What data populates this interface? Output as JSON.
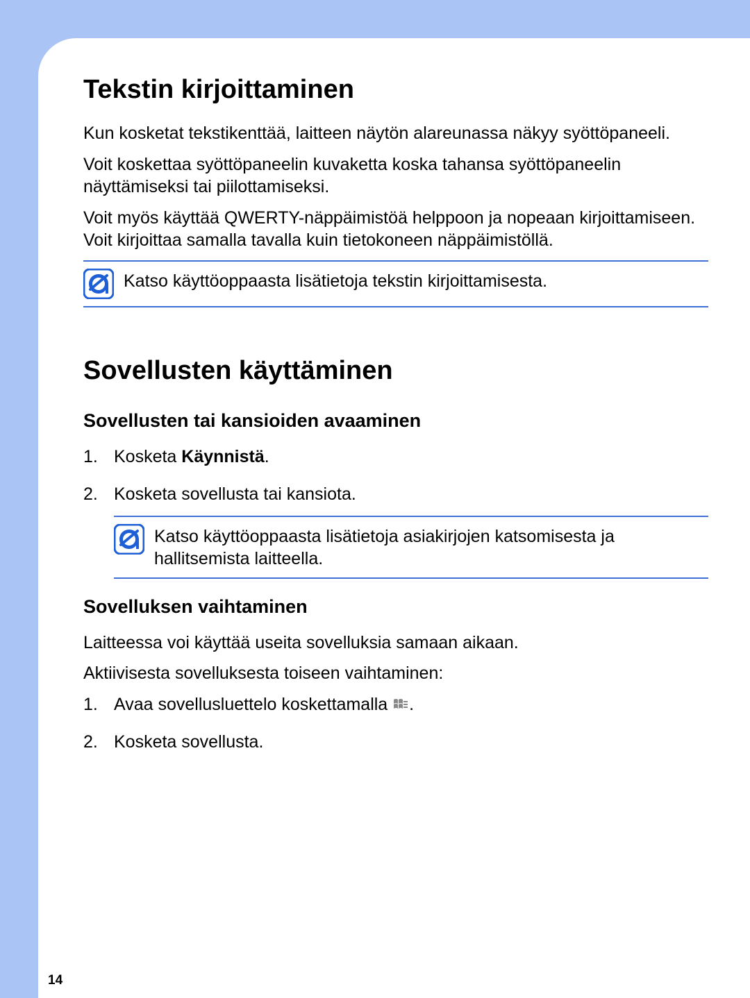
{
  "page_number": "14",
  "section1": {
    "heading": "Tekstin kirjoittaminen",
    "p1": "Kun kosketat tekstikenttää, laitteen näytön alareunassa näkyy syöttöpaneeli.",
    "p2": "Voit koskettaa syöttöpaneelin kuvaketta koska tahansa syöttöpaneelin näyttämiseksi tai piilottamiseksi.",
    "p3": "Voit myös käyttää QWERTY-näppäimistöä helppoon ja nopeaan kirjoittamiseen. Voit kirjoittaa samalla tavalla kuin tietokoneen näppäimistöllä.",
    "callout": "Katso käyttöoppaasta lisätietoja tekstin kirjoittamisesta."
  },
  "section2": {
    "heading": "Sovellusten käyttäminen",
    "sub1": {
      "heading": "Sovellusten tai kansioiden avaaminen",
      "step1_prefix": "Kosketa ",
      "step1_bold": "Käynnistä",
      "step1_suffix": ".",
      "step2": "Kosketa sovellusta tai kansiota.",
      "callout": "Katso käyttöoppaasta lisätietoja asiakirjojen katsomisesta ja hallitsemista laitteella."
    },
    "sub2": {
      "heading": "Sovelluksen vaihtaminen",
      "p1": "Laitteessa voi käyttää useita sovelluksia samaan aikaan.",
      "p2": "Aktiivisesta sovelluksesta toiseen vaihtaminen:",
      "step1_prefix": "Avaa sovellusluettelo koskettamalla ",
      "step1_suffix": ".",
      "step2": "Kosketa sovellusta."
    }
  }
}
